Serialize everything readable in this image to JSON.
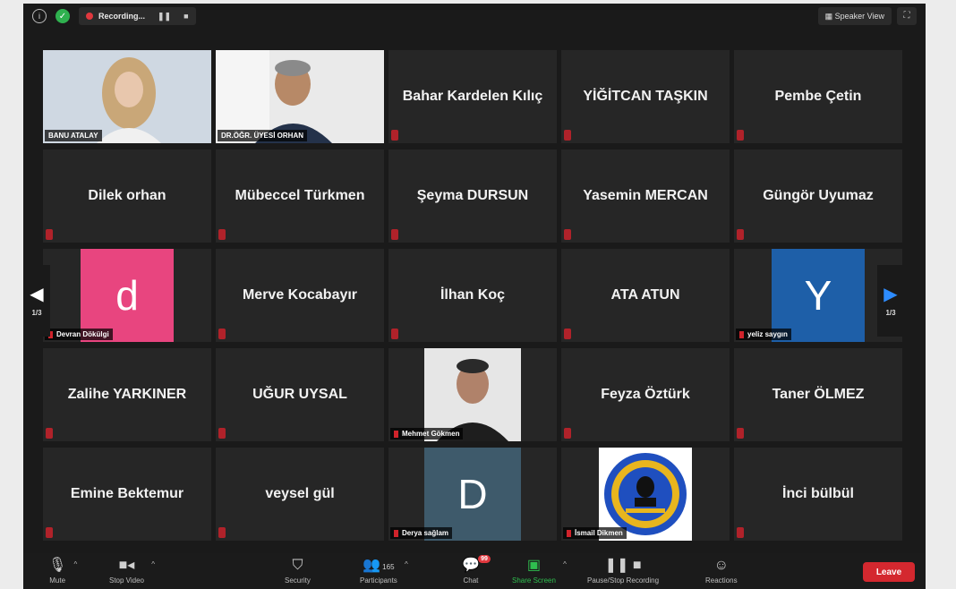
{
  "topbar": {
    "recording_label": "Recording...",
    "view_label": "Speaker View",
    "pause_symbol": "❚❚",
    "stop_symbol": "■",
    "fullscreen_symbol": "⛶",
    "info_symbol": "i",
    "shield_symbol": "✓"
  },
  "tiles": [
    {
      "name": "",
      "label": "BANU ATALAY",
      "type": "video",
      "active": true
    },
    {
      "name": "",
      "label": "DR.ÖĞR. ÜYESİ ORHAN",
      "type": "video"
    },
    {
      "name": "Bahar Kardelen Kılıç",
      "type": "name"
    },
    {
      "name": "YİĞİTCAN TAŞKIN",
      "type": "name"
    },
    {
      "name": "Pembe Çetin",
      "type": "name"
    },
    {
      "name": "Dilek orhan",
      "type": "name"
    },
    {
      "name": "Mübeccel Türkmen",
      "type": "name"
    },
    {
      "name": "Şeyma DURSUN",
      "type": "name"
    },
    {
      "name": "Yasemin MERCAN",
      "type": "name"
    },
    {
      "name": "Güngör Uyumaz",
      "type": "name"
    },
    {
      "name": "",
      "label": "Devran Dökülgi",
      "type": "avatar",
      "letter": "d",
      "color": "#e8457f"
    },
    {
      "name": "Merve Kocabayır",
      "type": "name"
    },
    {
      "name": "İlhan Koç",
      "type": "name"
    },
    {
      "name": "ATA ATUN",
      "type": "name"
    },
    {
      "name": "",
      "label": "yeliz saygın",
      "type": "avatar",
      "letter": "Y",
      "color": "#1e5fa8"
    },
    {
      "name": "Zalihe YARKINER",
      "type": "name"
    },
    {
      "name": "UĞUR UYSAL",
      "type": "name"
    },
    {
      "name": "",
      "label": "Mehmet Gökmen",
      "type": "video"
    },
    {
      "name": "Feyza Öztürk",
      "type": "name"
    },
    {
      "name": "Taner ÖLMEZ",
      "type": "name"
    },
    {
      "name": "Emine Bektemur",
      "type": "name"
    },
    {
      "name": "veysel gül",
      "type": "name"
    },
    {
      "name": "",
      "label": "Derya sağlam",
      "type": "avatar",
      "letter": "D",
      "color": "#3e5a6b"
    },
    {
      "name": "",
      "label": "İsmail Dikmen",
      "type": "logo"
    },
    {
      "name": "İnci bülbül",
      "type": "name"
    }
  ],
  "pager": {
    "left_page": "1/3",
    "right_page": "1/3"
  },
  "toolbar": {
    "mute": "Mute",
    "stop_video": "Stop Video",
    "security": "Security",
    "participants": "Participants",
    "participants_count": "165",
    "chat": "Chat",
    "chat_badge": "99",
    "share_screen": "Share Screen",
    "pause_recording": "Pause/Stop Recording",
    "reactions": "Reactions",
    "leave": "Leave"
  },
  "colors": {
    "accent_green": "#2fbf4f",
    "active_border": "#a6d83f",
    "leave_red": "#d4282f"
  }
}
